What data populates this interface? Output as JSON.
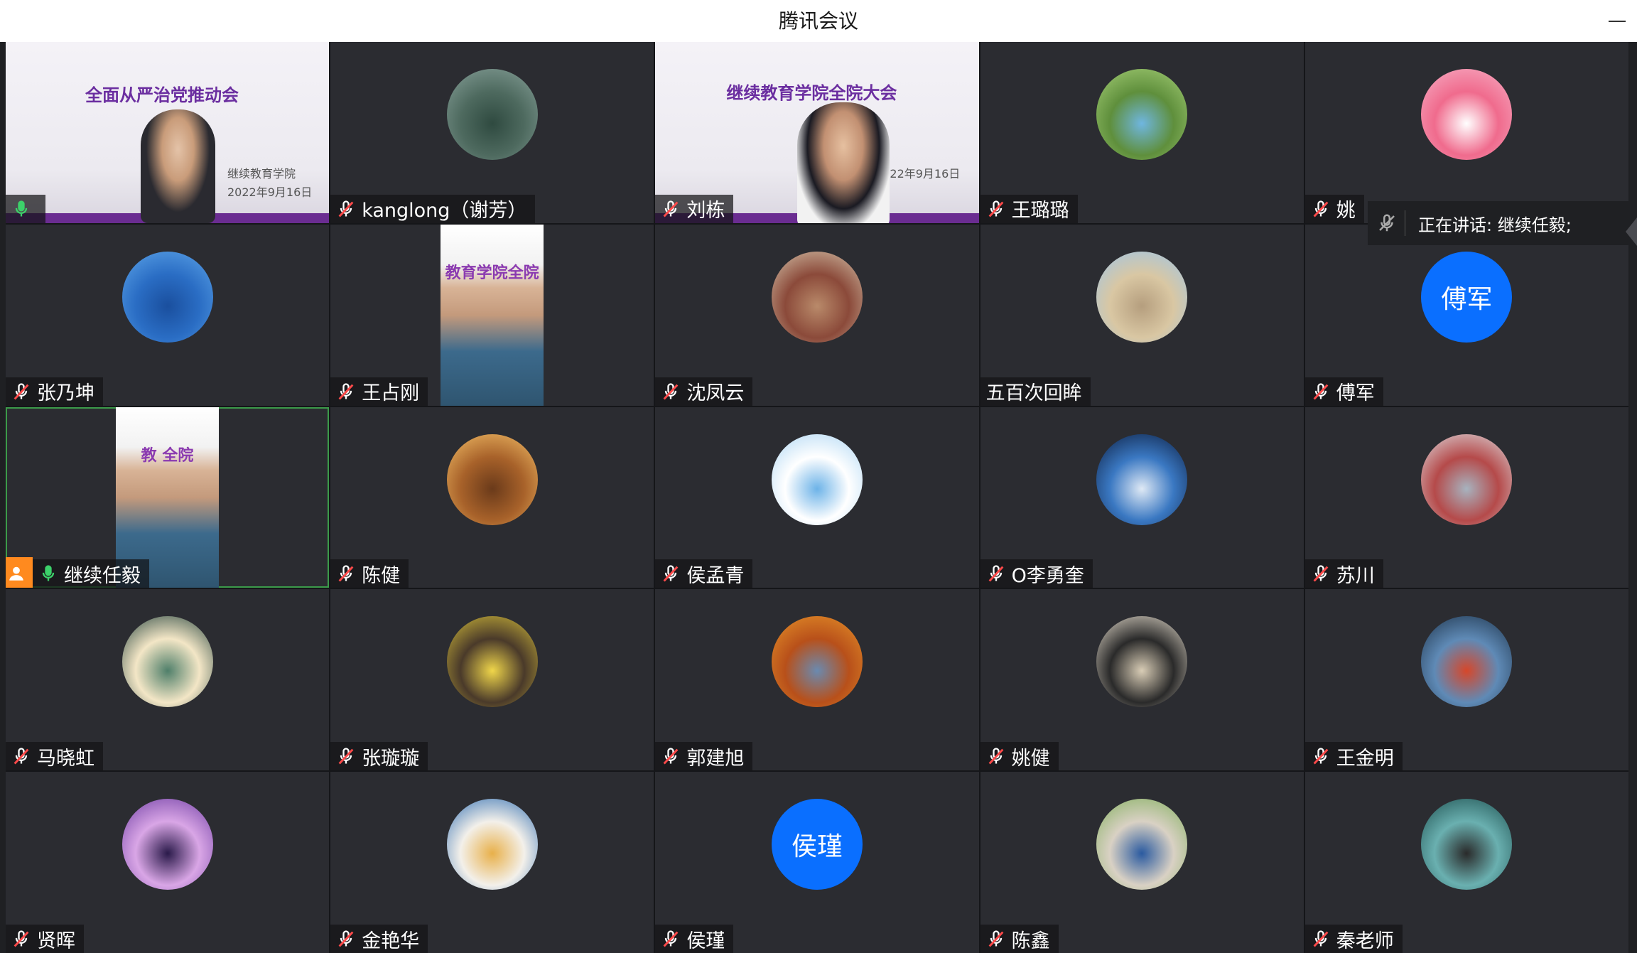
{
  "app": {
    "title": "腾讯会议"
  },
  "speaking_indicator": {
    "label": "正在讲话: 继续任毅;"
  },
  "participants": [
    {
      "name": "",
      "kind": "video",
      "slide_title": "全面从严治党推动会",
      "slide_sub": "继续教育学院",
      "slide_date": "2022年9月16日"
    },
    {
      "name": "kanglong（谢芳）",
      "kind": "avatar",
      "muted": true,
      "colors": [
        "#8aa39c",
        "#4e6a5f",
        "#2f4a40"
      ]
    },
    {
      "name": "刘栋",
      "kind": "video",
      "muted": true,
      "slide_title": "继续教育学院全院大会",
      "slide_date": "22年9月16日"
    },
    {
      "name": "王璐璐",
      "kind": "avatar",
      "muted": true,
      "colors": [
        "#a9d27a",
        "#5f8f3c",
        "#6fb6e0"
      ]
    },
    {
      "name": "姚",
      "kind": "avatar",
      "muted": true,
      "colors": [
        "#f7b3c9",
        "#f06b8d",
        "#ffffff"
      ]
    },
    {
      "name": "张乃坤",
      "kind": "avatar",
      "muted": true,
      "colors": [
        "#5fa7ea",
        "#2a6dc4",
        "#1a4f9e"
      ]
    },
    {
      "name": "王占刚",
      "kind": "video",
      "muted": true,
      "slide_title": "教育学院全院"
    },
    {
      "name": "沈凤云",
      "kind": "avatar",
      "muted": true,
      "colors": [
        "#d8c9b0",
        "#8b4a3a",
        "#b98a6a"
      ]
    },
    {
      "name": "五百次回眸",
      "kind": "avatar",
      "muted": false,
      "noicon": true,
      "colors": [
        "#9cc6ea",
        "#d9c7a3",
        "#b59e7e"
      ]
    },
    {
      "name": "傅军",
      "kind": "text",
      "muted": true,
      "initials": "傅军"
    },
    {
      "name": "继续任毅",
      "kind": "video",
      "muted": false,
      "host": true,
      "active": true,
      "slide_title": "教 全院"
    },
    {
      "name": "陈健",
      "kind": "avatar",
      "muted": true,
      "colors": [
        "#f6c36a",
        "#a8622a",
        "#6a3a1a"
      ]
    },
    {
      "name": "侯孟青",
      "kind": "avatar",
      "muted": true,
      "colors": [
        "#a9d4f3",
        "#ffffff",
        "#6db3e8"
      ]
    },
    {
      "name": "Ο李勇奎",
      "kind": "avatar",
      "muted": true,
      "colors": [
        "#0b1a3a",
        "#3a78c2",
        "#dfe9f5"
      ]
    },
    {
      "name": "苏川",
      "kind": "avatar",
      "muted": true,
      "colors": [
        "#dfe3e7",
        "#b54a4a",
        "#a7b3bf"
      ]
    },
    {
      "name": "马晓虹",
      "kind": "avatar",
      "muted": true,
      "colors": [
        "#1f3f3a",
        "#f3e6c6",
        "#4f7f6a"
      ]
    },
    {
      "name": "张璇璇",
      "kind": "avatar",
      "muted": true,
      "colors": [
        "#d9c23a",
        "#4a3a2a",
        "#f0d64a"
      ]
    },
    {
      "name": "郭建旭",
      "kind": "avatar",
      "muted": true,
      "colors": [
        "#e8962a",
        "#b8501a",
        "#6a8ab0"
      ]
    },
    {
      "name": "姚健",
      "kind": "avatar",
      "muted": true,
      "colors": [
        "#efe6d6",
        "#2a2a2a",
        "#d9cdb6"
      ]
    },
    {
      "name": "王金明",
      "kind": "avatar",
      "muted": true,
      "colors": [
        "#1a2f45",
        "#5f8ab6",
        "#d6472a"
      ]
    },
    {
      "name": "贤晖",
      "kind": "avatar",
      "muted": true,
      "colors": [
        "#6a3aa0",
        "#d9a6e6",
        "#2a1a4a"
      ]
    },
    {
      "name": "金艳华",
      "kind": "avatar",
      "muted": true,
      "colors": [
        "#2a6ab0",
        "#f3f0ea",
        "#e8b04a"
      ]
    },
    {
      "name": "侯瑾",
      "kind": "text",
      "muted": true,
      "initials": "侯瑾"
    },
    {
      "name": "陈鑫",
      "kind": "avatar",
      "muted": true,
      "colors": [
        "#7fae5a",
        "#d9d1c4",
        "#2a5aa0"
      ]
    },
    {
      "name": "秦老师",
      "kind": "avatar",
      "muted": true,
      "colors": [
        "#1a4a4a",
        "#6ab0b0",
        "#2a2a2a"
      ]
    }
  ]
}
